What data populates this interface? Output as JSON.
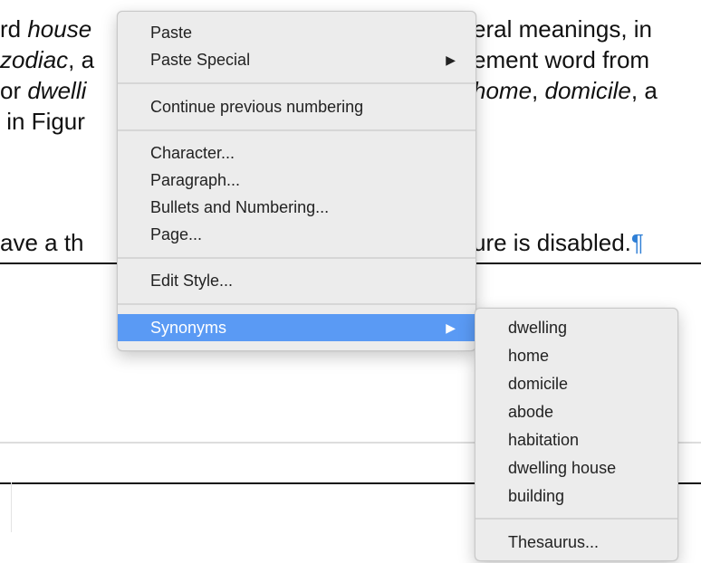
{
  "document": {
    "line1_a": "rd ",
    "line1_em": "house",
    "line1_tail": "eral meanings, in",
    "line2_em": "zodiac",
    "line2_mid": ", a",
    "line2_tail": "ement word from",
    "line3_head": "or ",
    "line3_em": "dwelli",
    "line3_tail_em1": "home",
    "line3_tail_mid": ", ",
    "line3_tail_em2": "domicile",
    "line3_tail_end": ", a",
    "line4_head": " in Figur",
    "line5_head": "ave a th",
    "line5_tail": "ure is disabled.",
    "pilcrow": "¶"
  },
  "context_menu": {
    "items": [
      {
        "label": "Paste"
      },
      {
        "label": "Paste Special",
        "has_submenu": true
      },
      {
        "label": "Continue previous numbering"
      },
      {
        "label": "Character..."
      },
      {
        "label": "Paragraph..."
      },
      {
        "label": "Bullets and Numbering..."
      },
      {
        "label": "Page..."
      },
      {
        "label": "Edit Style..."
      },
      {
        "label": "Synonyms",
        "has_submenu": true,
        "highlighted": true
      }
    ],
    "submenu_arrow": "▶"
  },
  "synonyms_submenu": {
    "items": [
      {
        "label": "dwelling"
      },
      {
        "label": "home"
      },
      {
        "label": "domicile"
      },
      {
        "label": "abode"
      },
      {
        "label": "habitation"
      },
      {
        "label": "dwelling house"
      },
      {
        "label": "building"
      },
      {
        "label": "Thesaurus..."
      }
    ]
  },
  "colors": {
    "highlight": "#5a9af4",
    "menu_background": "#ececec",
    "pilcrow": "#2f7fd6"
  }
}
